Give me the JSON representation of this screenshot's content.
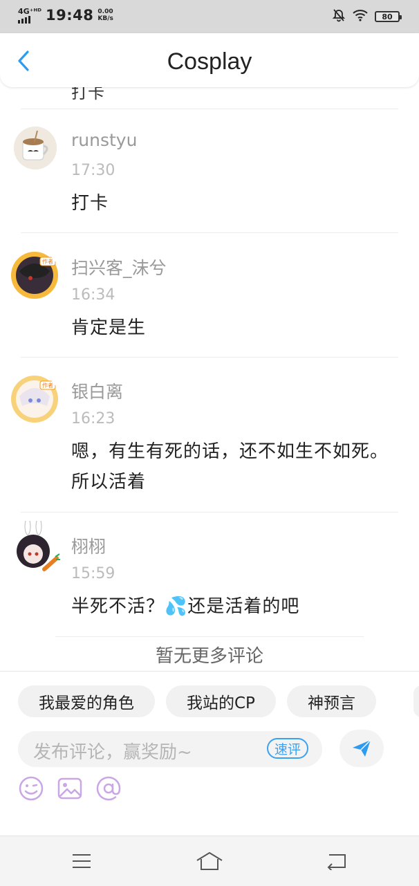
{
  "status_bar": {
    "network": "4G⁺ᴴᴰ",
    "time": "19:48",
    "speed_value": "0.00",
    "speed_unit": "KB/s",
    "battery": "80",
    "icons": [
      "signal-icon",
      "mute-bell-icon",
      "wifi-icon",
      "battery-icon"
    ]
  },
  "header": {
    "title": "Cosplay",
    "back_icon": "chevron-left-icon",
    "accent_color": "#2d9cf0"
  },
  "comments": {
    "partial_prev_text": "打卡",
    "items": [
      {
        "user": "runstyu",
        "time": "17:30",
        "text": "打卡"
      },
      {
        "user": "扫兴客_沫兮",
        "time": "16:34",
        "text": "肯定是生"
      },
      {
        "user": "银白离",
        "time": "16:23",
        "text": "嗯，有生有死的话，还不如生不如死。所以活着"
      },
      {
        "user": "栩栩",
        "time": "15:59",
        "text": "半死不活？💦还是活着的吧"
      }
    ],
    "no_more": "暂无更多评论"
  },
  "composer": {
    "chips": [
      "我最爱的角色",
      "我站的CP",
      "神预言"
    ],
    "placeholder": "发布评论，赢奖励~",
    "quick_label": "速评",
    "send_icon": "send-icon",
    "tool_icons": [
      "emoji-icon",
      "image-icon",
      "at-icon"
    ],
    "tool_color": "#c9a6e6"
  },
  "nav_bar": {
    "icons": [
      "menu-icon",
      "home-icon",
      "back-icon"
    ]
  }
}
